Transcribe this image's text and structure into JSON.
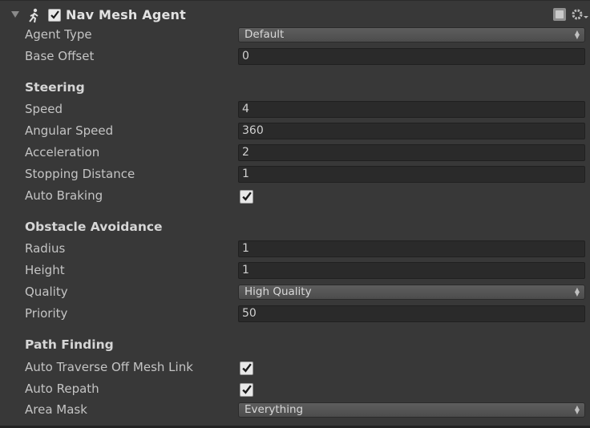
{
  "component": {
    "title": "Nav Mesh Agent",
    "enabled": true,
    "icons": [
      "nav-agent-icon",
      "help-icon",
      "gear-icon"
    ]
  },
  "agent": {
    "agent_type_label": "Agent Type",
    "agent_type_value": "Default",
    "base_offset_label": "Base Offset",
    "base_offset_value": "0"
  },
  "steering": {
    "title": "Steering",
    "speed_label": "Speed",
    "speed_value": "4",
    "angular_speed_label": "Angular Speed",
    "angular_speed_value": "360",
    "acceleration_label": "Acceleration",
    "acceleration_value": "2",
    "stopping_distance_label": "Stopping Distance",
    "stopping_distance_value": "1",
    "auto_braking_label": "Auto Braking",
    "auto_braking": true
  },
  "obstacle_avoidance": {
    "title": "Obstacle Avoidance",
    "radius_label": "Radius",
    "radius_value": "1",
    "height_label": "Height",
    "height_value": "1",
    "quality_label": "Quality",
    "quality_value": "High Quality",
    "priority_label": "Priority",
    "priority_value": "50"
  },
  "path_finding": {
    "title": "Path Finding",
    "auto_traverse_label": "Auto Traverse Off Mesh Link",
    "auto_traverse": true,
    "auto_repath_label": "Auto Repath",
    "auto_repath": true,
    "area_mask_label": "Area Mask",
    "area_mask_value": "Everything"
  },
  "colors": {
    "background": "#383838",
    "field": "#2a2a2a",
    "text": "#c4c4c4"
  }
}
